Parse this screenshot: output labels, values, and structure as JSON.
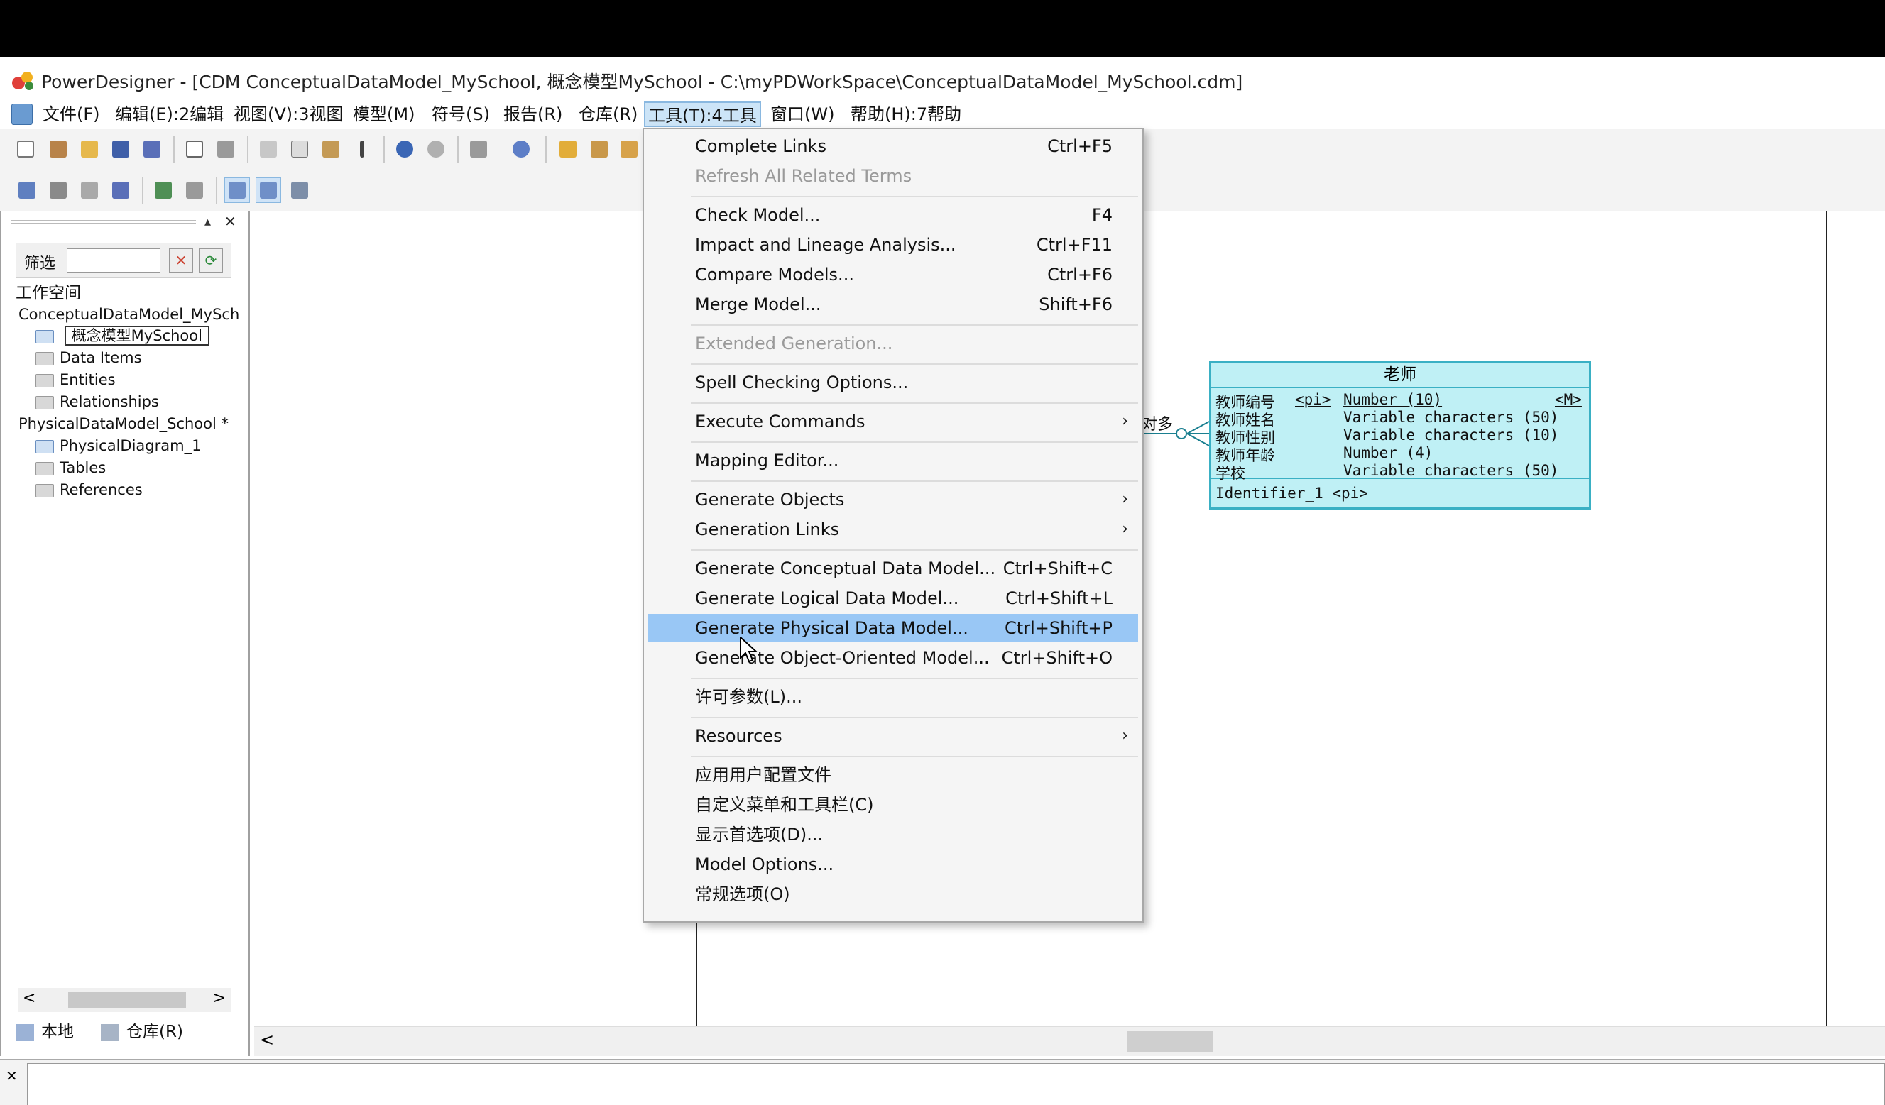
{
  "window": {
    "title": "PowerDesigner - [CDM ConceptualDataModel_MySchool, 概念模型MySchool - C:\\myPDWorkSpace\\ConceptualDataModel_MySchool.cdm]"
  },
  "menubar": {
    "items": [
      "文件(F)",
      "编辑(E):2编辑",
      "视图(V):3视图",
      "模型(M)",
      "符号(S)",
      "报告(R)",
      "仓库(R)",
      "工具(T):4工具",
      "窗口(W)",
      "帮助(H):7帮助"
    ]
  },
  "tools_menu": {
    "items": [
      {
        "label": "Complete Links",
        "shortcut": "Ctrl+F5"
      },
      {
        "label": "Refresh All Related Terms",
        "shortcut": ""
      },
      {
        "label": "Check Model...",
        "shortcut": "F4"
      },
      {
        "label": "Impact and Lineage Analysis...",
        "shortcut": "Ctrl+F11"
      },
      {
        "label": "Compare Models...",
        "shortcut": "Ctrl+F6"
      },
      {
        "label": "Merge Model...",
        "shortcut": "Shift+F6"
      },
      {
        "label": "Extended Generation...",
        "shortcut": ""
      },
      {
        "label": "Spell Checking Options...",
        "shortcut": ""
      },
      {
        "label": "Execute Commands",
        "shortcut": ""
      },
      {
        "label": "Mapping Editor...",
        "shortcut": ""
      },
      {
        "label": "Generate Objects",
        "shortcut": ""
      },
      {
        "label": "Generation Links",
        "shortcut": ""
      },
      {
        "label": "Generate Conceptual Data Model...",
        "shortcut": "Ctrl+Shift+C"
      },
      {
        "label": "Generate Logical Data Model...",
        "shortcut": "Ctrl+Shift+L"
      },
      {
        "label": "Generate Physical Data Model...",
        "shortcut": "Ctrl+Shift+P"
      },
      {
        "label": "Generate Object-Oriented Model...",
        "shortcut": "Ctrl+Shift+O"
      },
      {
        "label": "许可参数(L)...",
        "shortcut": ""
      },
      {
        "label": "Resources",
        "shortcut": ""
      },
      {
        "label": "应用用户配置文件",
        "shortcut": ""
      },
      {
        "label": "自定义菜单和工具栏(C)",
        "shortcut": ""
      },
      {
        "label": "显示首选项(D)...",
        "shortcut": ""
      },
      {
        "label": "Model Options...",
        "shortcut": ""
      },
      {
        "label": "常规选项(O)",
        "shortcut": ""
      }
    ]
  },
  "browser": {
    "filter_label": "筛选",
    "workspace": "工作空间",
    "tree": [
      "ConceptualDataModel_MySch",
      "概念模型MySchool",
      "Data Items",
      "Entities",
      "Relationships",
      "PhysicalDataModel_School *",
      "PhysicalDiagram_1",
      "Tables",
      "References"
    ],
    "tabs": [
      "本地",
      "仓库(R)"
    ]
  },
  "entity": {
    "name": "老师",
    "attributes": [
      {
        "name": "教师编号",
        "pi": "<pi>",
        "type": "Number (10)",
        "m": "<M>"
      },
      {
        "name": "教师姓名",
        "pi": "",
        "type": "Variable characters (50)",
        "m": ""
      },
      {
        "name": "教师性别",
        "pi": "",
        "type": "Variable characters (10)",
        "m": ""
      },
      {
        "name": "教师年龄",
        "pi": "",
        "type": "Number (4)",
        "m": ""
      },
      {
        "name": "学校",
        "pi": "",
        "type": "Variable characters (50)",
        "m": ""
      }
    ],
    "identifier": "Identifier_1  <pi>"
  },
  "relationship_label": "对多",
  "icons": {
    "submenu": "›",
    "scroll_left": "<",
    "scroll_right": ">",
    "close": "✕"
  }
}
